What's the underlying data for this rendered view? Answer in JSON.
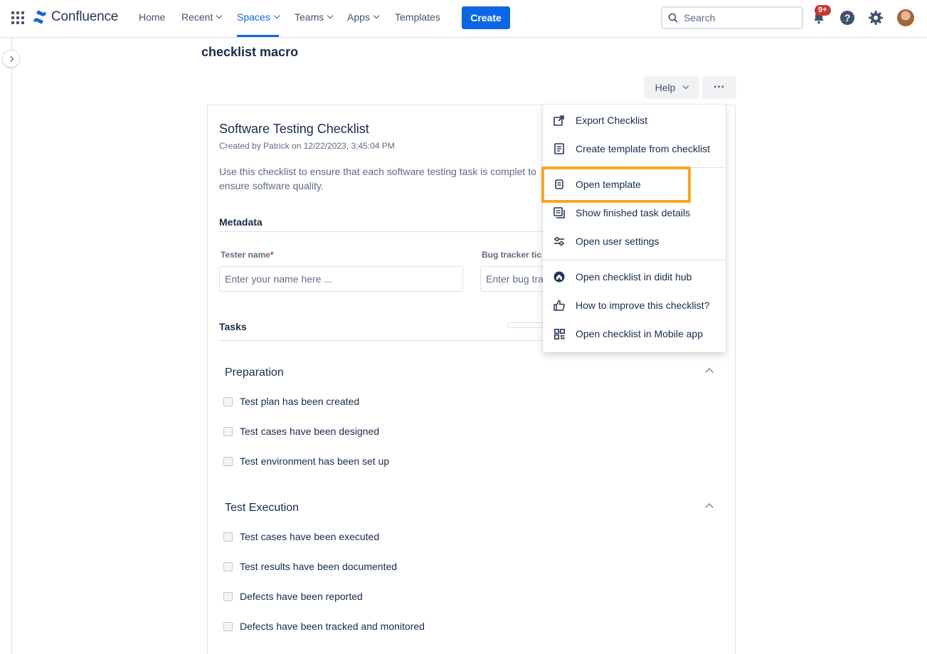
{
  "nav": {
    "logo_text": "Confluence",
    "items": [
      {
        "label": "Home",
        "has_chevron": false
      },
      {
        "label": "Recent",
        "has_chevron": true
      },
      {
        "label": "Spaces",
        "has_chevron": true,
        "active": true
      },
      {
        "label": "Teams",
        "has_chevron": true
      },
      {
        "label": "Apps",
        "has_chevron": true
      },
      {
        "label": "Templates",
        "has_chevron": false
      }
    ],
    "create_label": "Create",
    "search_placeholder": "Search",
    "notification_badge": "9+",
    "accent_color": "#0c66e4"
  },
  "page": {
    "title": "checklist macro",
    "help_label": "Help",
    "more_label": "···"
  },
  "checklist": {
    "title": "Software Testing Checklist",
    "created": "Created by Patrick on 12/22/2023, 3:45:04 PM",
    "description": "Use this checklist to ensure that each software testing task is complet to ensure software quality.",
    "metadata_heading": "Metadata",
    "fields": [
      {
        "label": "Tester name",
        "required": "*",
        "placeholder": "Enter your name here ..."
      },
      {
        "label": "Bug tracker tic",
        "required": "",
        "placeholder": "Enter bug tra"
      }
    ],
    "tasks_heading": "Tasks",
    "groups": [
      {
        "name": "Preparation",
        "tasks": [
          "Test plan has been created",
          "Test cases have been designed",
          "Test environment has been set up"
        ]
      },
      {
        "name": "Test Execution",
        "tasks": [
          "Test cases have been executed",
          "Test results have been documented",
          "Defects have been reported",
          "Defects have been tracked and monitored"
        ]
      }
    ]
  },
  "menu": {
    "items": [
      {
        "label": "Export Checklist",
        "icon": "export-icon"
      },
      {
        "label": "Create template from checklist",
        "icon": "document-icon"
      },
      {
        "label": "Open template",
        "icon": "template-icon",
        "highlighted": true
      },
      {
        "label": "Show finished task details",
        "icon": "details-icon"
      },
      {
        "label": "Open user settings",
        "icon": "settings-sliders-icon"
      },
      {
        "label": "Open checklist in didit hub",
        "icon": "home-icon"
      },
      {
        "label": "How to improve this checklist?",
        "icon": "thumbs-up-icon"
      },
      {
        "label": "Open checklist in Mobile app",
        "icon": "qr-code-icon"
      }
    ],
    "highlight_color": "#f6a623"
  }
}
